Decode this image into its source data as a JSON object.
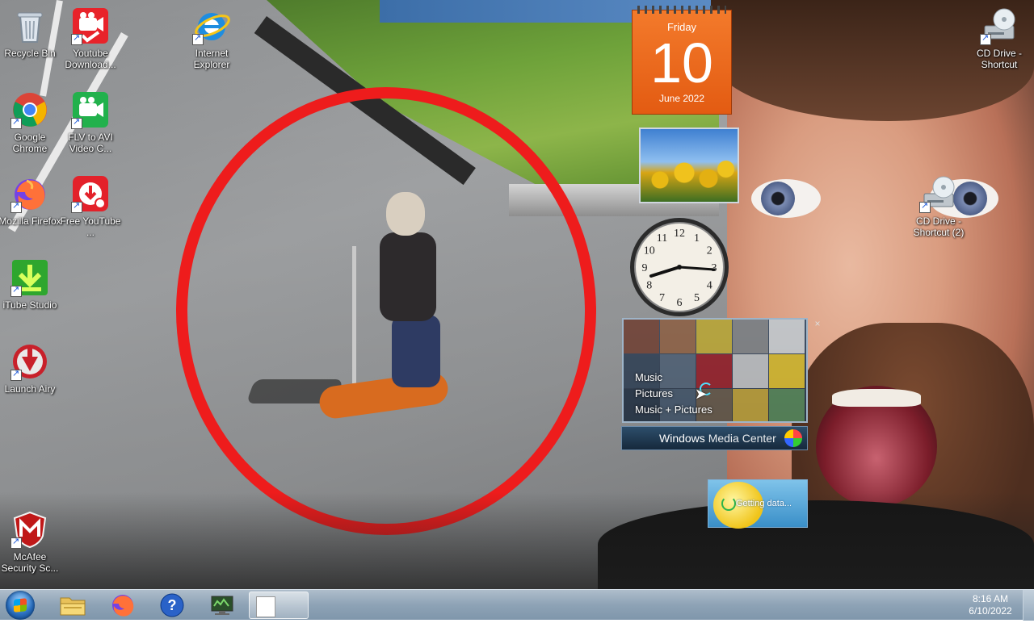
{
  "desktop_icons": {
    "recycle_bin": "Recycle Bin",
    "youtube_downloader": "Youtube Download...",
    "internet_explorer": "Internet Explorer",
    "google_chrome": "Google Chrome",
    "flv_to_avi": "FLV to AVI Video C...",
    "mozilla_firefox": "Mozilla Firefox",
    "free_youtube": "Free YouTube ...",
    "itube_studio": "iTube Studio",
    "launch_airy": "Launch Airy",
    "mcafee": "McAfee Security Sc...",
    "cd_drive": "CD Drive - Shortcut",
    "cd_drive_2": "CD Drive - Shortcut (2)"
  },
  "calendar_gadget": {
    "weekday": "Friday",
    "day": "10",
    "month_year": "June 2022"
  },
  "clock_gadget": {
    "numerals": [
      "12",
      "1",
      "2",
      "3",
      "4",
      "5",
      "6",
      "7",
      "8",
      "9",
      "10",
      "11"
    ]
  },
  "media_center_gadget": {
    "menu": [
      "Music",
      "Pictures",
      "Music + Pictures"
    ],
    "title_windows": "Windows",
    "title_product": "Media Center",
    "close": "×"
  },
  "weather_gadget": {
    "status": "Getting data..."
  },
  "taskbar": {
    "time": "8:16 AM",
    "date": "6/10/2022"
  },
  "colors": {
    "highlight_circle": "#ee1c1c",
    "calendar_orange": "#e35b12",
    "taskbar": "#8ea3b6"
  }
}
